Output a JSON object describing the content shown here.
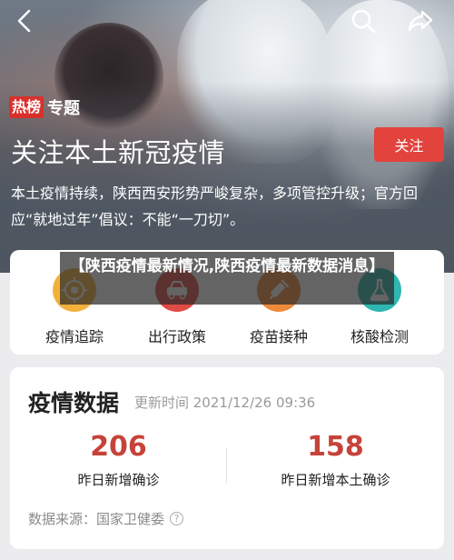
{
  "hero": {
    "tag_hot": "热榜",
    "tag_topic": "专题",
    "title": "关注本土新冠疫情",
    "follow_label": "关注",
    "description": "本土疫情持续，陕西西安形势严峻复杂，多项管控升级；官方回应“就地过年”倡议：不能“一刀切”。"
  },
  "overlay": {
    "text": "【陕西疫情最新情况,陕西疫情最新数据消息】"
  },
  "nav": {
    "items": [
      {
        "label": "疫情追踪",
        "icon": "target-icon",
        "color": "#f2b13b"
      },
      {
        "label": "出行政策",
        "icon": "car-icon",
        "color": "#e04b45"
      },
      {
        "label": "疫苗接种",
        "icon": "syringe-icon",
        "color": "#f08a3a"
      },
      {
        "label": "核酸检测",
        "icon": "flask-icon",
        "color": "#2fb6b0"
      }
    ]
  },
  "stats": {
    "title": "疫情数据",
    "updated": "更新时间 2021/12/26 09:36",
    "items": [
      {
        "value": "206",
        "label": "昨日新增确诊"
      },
      {
        "value": "158",
        "label": "昨日新增本土确诊"
      }
    ],
    "source": "数据来源：国家卫健委"
  }
}
